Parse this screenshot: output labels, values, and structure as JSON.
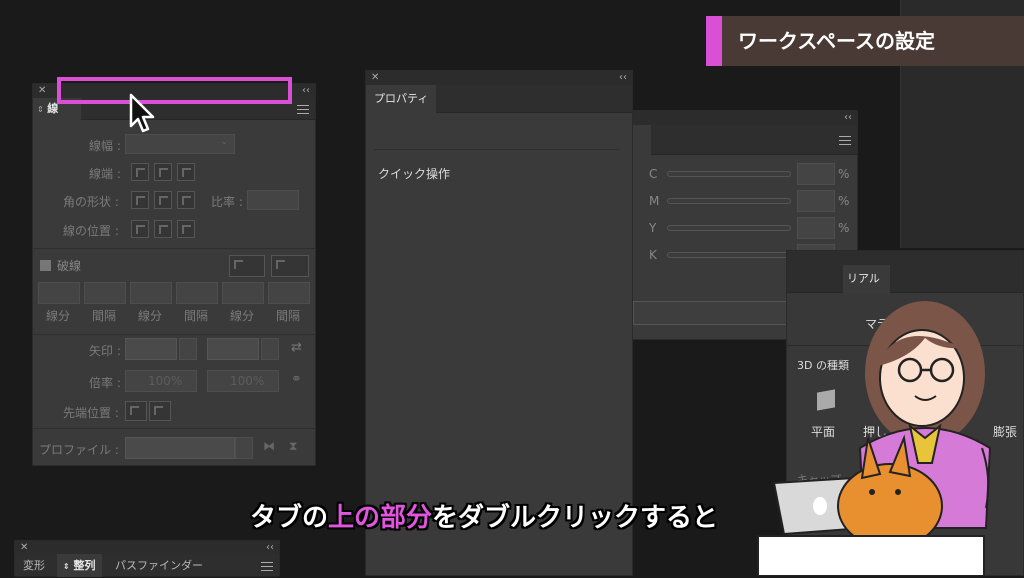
{
  "title_banner": {
    "text": "ワークスペースの設定",
    "accent": "#d94fd6",
    "bg": "#4a3a36"
  },
  "stroke_panel": {
    "tab_label": "線",
    "width_label": "線幅 :",
    "cap_label": "線端 :",
    "corner_label": "角の形状 :",
    "ratio_label": "比率 :",
    "align_label": "線の位置 :",
    "dashed_label": "破線",
    "dash_labels": [
      "線分",
      "間隔",
      "線分",
      "間隔",
      "線分",
      "間隔"
    ],
    "arrow_label": "矢印 :",
    "scale_label": "倍率 :",
    "scale_values": [
      "100%",
      "100%"
    ],
    "tip_label": "先端位置 :",
    "profile_label": "プロファイル :"
  },
  "properties_panel": {
    "tab_label": "プロパティ",
    "quick_actions_label": "クイック操作"
  },
  "color_panel": {
    "channels": [
      "C",
      "M",
      "Y",
      "K"
    ],
    "unit": "%"
  },
  "panel_3d": {
    "tab_label": "リアル",
    "sub_label": "マテ",
    "types_label": "3D の種類",
    "type_items": [
      "平面",
      "押し",
      "膨張"
    ],
    "cap_label": "キャップ"
  },
  "align_panel": {
    "tabs": [
      "変形",
      "整列",
      "パスファインダー"
    ]
  },
  "close_glyph": "✕",
  "collapse_glyph": "‹‹",
  "subtitle": {
    "parts": [
      {
        "text": "タブの",
        "color": "#ffffff"
      },
      {
        "text": "上の部分",
        "color": "#e255e0"
      },
      {
        "text": "をダブルクリックすると",
        "color": "#ffffff"
      }
    ]
  },
  "highlight_color": "#d94fd6"
}
